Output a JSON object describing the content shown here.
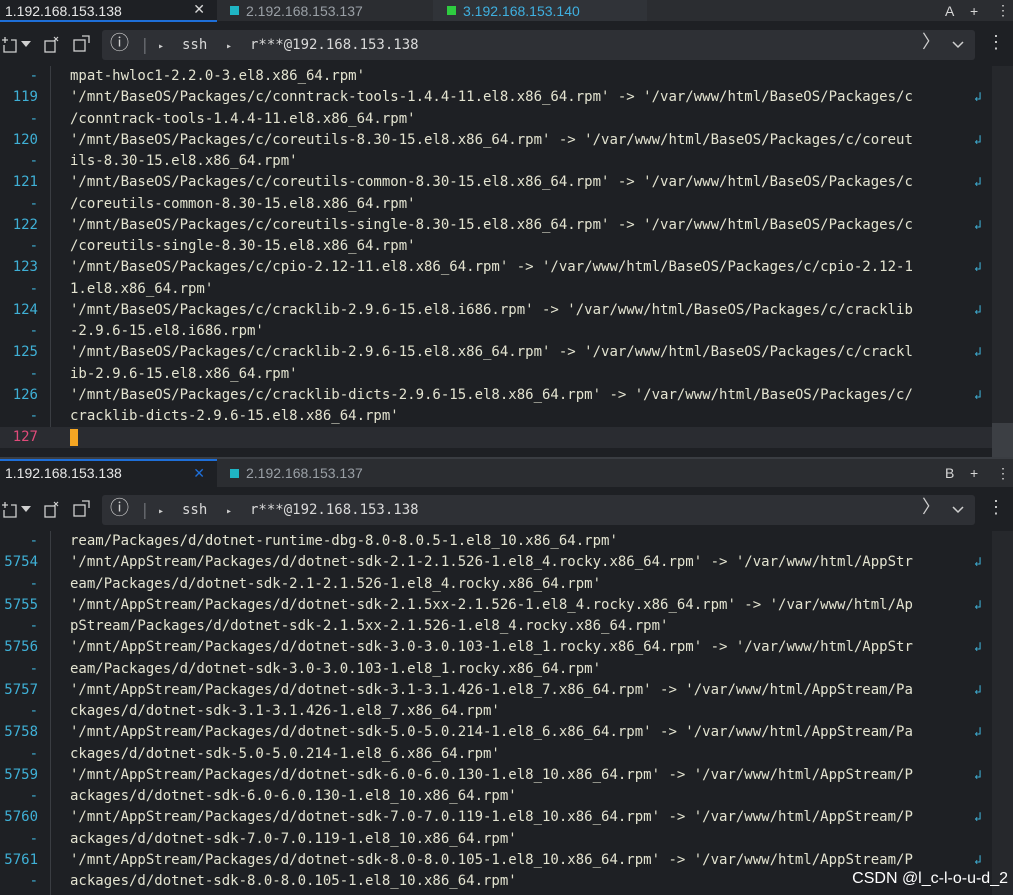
{
  "pane1": {
    "tabs": [
      {
        "label": "1.192.168.153.138",
        "color": "",
        "active": true
      },
      {
        "label": "2.192.168.153.137",
        "color": "#1fb5c4",
        "active": false
      },
      {
        "label": "3.192.168.153.140",
        "color": "#2ecc40",
        "active": false
      }
    ],
    "tab_close": "✕",
    "corner_letter": "A",
    "add_label": "+",
    "more_label": "⋮",
    "toolbar": {
      "info": "ⓘ",
      "protocol": "ssh",
      "host": "r***@192.168.153.138"
    },
    "lines": [
      {
        "num": "-",
        "text": "mpat-hwloc1-2.2.0-3.el8.x86_64.rpm'"
      },
      {
        "num": "119",
        "text": "'/mnt/BaseOS/Packages/c/conntrack-tools-1.4.4-11.el8.x86_64.rpm' -> '/var/www/html/BaseOS/Packages/c"
      },
      {
        "num": "-",
        "text": "/conntrack-tools-1.4.4-11.el8.x86_64.rpm'"
      },
      {
        "num": "120",
        "text": "'/mnt/BaseOS/Packages/c/coreutils-8.30-15.el8.x86_64.rpm' -> '/var/www/html/BaseOS/Packages/c/coreut"
      },
      {
        "num": "-",
        "text": "ils-8.30-15.el8.x86_64.rpm'"
      },
      {
        "num": "121",
        "text": "'/mnt/BaseOS/Packages/c/coreutils-common-8.30-15.el8.x86_64.rpm' -> '/var/www/html/BaseOS/Packages/c"
      },
      {
        "num": "-",
        "text": "/coreutils-common-8.30-15.el8.x86_64.rpm'"
      },
      {
        "num": "122",
        "text": "'/mnt/BaseOS/Packages/c/coreutils-single-8.30-15.el8.x86_64.rpm' -> '/var/www/html/BaseOS/Packages/c"
      },
      {
        "num": "-",
        "text": "/coreutils-single-8.30-15.el8.x86_64.rpm'"
      },
      {
        "num": "123",
        "text": "'/mnt/BaseOS/Packages/c/cpio-2.12-11.el8.x86_64.rpm' -> '/var/www/html/BaseOS/Packages/c/cpio-2.12-1"
      },
      {
        "num": "-",
        "text": "1.el8.x86_64.rpm'"
      },
      {
        "num": "124",
        "text": "'/mnt/BaseOS/Packages/c/cracklib-2.9.6-15.el8.i686.rpm' -> '/var/www/html/BaseOS/Packages/c/cracklib"
      },
      {
        "num": "-",
        "text": "-2.9.6-15.el8.i686.rpm'"
      },
      {
        "num": "125",
        "text": "'/mnt/BaseOS/Packages/c/cracklib-2.9.6-15.el8.x86_64.rpm' -> '/var/www/html/BaseOS/Packages/c/crackl"
      },
      {
        "num": "-",
        "text": "ib-2.9.6-15.el8.x86_64.rpm'"
      },
      {
        "num": "126",
        "text": "'/mnt/BaseOS/Packages/c/cracklib-dicts-2.9.6-15.el8.x86_64.rpm' -> '/var/www/html/BaseOS/Packages/c/"
      },
      {
        "num": "-",
        "text": "cracklib-dicts-2.9.6-15.el8.x86_64.rpm'"
      }
    ],
    "prompt_line_num": "127"
  },
  "pane2": {
    "tabs": [
      {
        "label": "1.192.168.153.138",
        "color": "",
        "active": true
      },
      {
        "label": "2.192.168.153.137",
        "color": "#1fb5c4",
        "active": false
      }
    ],
    "tab_close": "✕",
    "corner_letter": "B",
    "add_label": "+",
    "more_label": "⋮",
    "toolbar": {
      "info": "ⓘ",
      "protocol": "ssh",
      "host": "r***@192.168.153.138"
    },
    "lines": [
      {
        "num": "-",
        "text": "ream/Packages/d/dotnet-runtime-dbg-8.0-8.0.5-1.el8_10.x86_64.rpm'"
      },
      {
        "num": "5754",
        "text": "'/mnt/AppStream/Packages/d/dotnet-sdk-2.1-2.1.526-1.el8_4.rocky.x86_64.rpm' -> '/var/www/html/AppStr"
      },
      {
        "num": "-",
        "text": "eam/Packages/d/dotnet-sdk-2.1-2.1.526-1.el8_4.rocky.x86_64.rpm'"
      },
      {
        "num": "5755",
        "text": "'/mnt/AppStream/Packages/d/dotnet-sdk-2.1.5xx-2.1.526-1.el8_4.rocky.x86_64.rpm' -> '/var/www/html/Ap"
      },
      {
        "num": "-",
        "text": "pStream/Packages/d/dotnet-sdk-2.1.5xx-2.1.526-1.el8_4.rocky.x86_64.rpm'"
      },
      {
        "num": "5756",
        "text": "'/mnt/AppStream/Packages/d/dotnet-sdk-3.0-3.0.103-1.el8_1.rocky.x86_64.rpm' -> '/var/www/html/AppStr"
      },
      {
        "num": "-",
        "text": "eam/Packages/d/dotnet-sdk-3.0-3.0.103-1.el8_1.rocky.x86_64.rpm'"
      },
      {
        "num": "5757",
        "text": "'/mnt/AppStream/Packages/d/dotnet-sdk-3.1-3.1.426-1.el8_7.x86_64.rpm' -> '/var/www/html/AppStream/Pa"
      },
      {
        "num": "-",
        "text": "ckages/d/dotnet-sdk-3.1-3.1.426-1.el8_7.x86_64.rpm'"
      },
      {
        "num": "5758",
        "text": "'/mnt/AppStream/Packages/d/dotnet-sdk-5.0-5.0.214-1.el8_6.x86_64.rpm' -> '/var/www/html/AppStream/Pa"
      },
      {
        "num": "-",
        "text": "ckages/d/dotnet-sdk-5.0-5.0.214-1.el8_6.x86_64.rpm'"
      },
      {
        "num": "5759",
        "text": "'/mnt/AppStream/Packages/d/dotnet-sdk-6.0-6.0.130-1.el8_10.x86_64.rpm' -> '/var/www/html/AppStream/P"
      },
      {
        "num": "-",
        "text": "ackages/d/dotnet-sdk-6.0-6.0.130-1.el8_10.x86_64.rpm'"
      },
      {
        "num": "5760",
        "text": "'/mnt/AppStream/Packages/d/dotnet-sdk-7.0-7.0.119-1.el8_10.x86_64.rpm' -> '/var/www/html/AppStream/P"
      },
      {
        "num": "-",
        "text": "ackages/d/dotnet-sdk-7.0-7.0.119-1.el8_10.x86_64.rpm'"
      },
      {
        "num": "5761",
        "text": "'/mnt/AppStream/Packages/d/dotnet-sdk-8.0-8.0.105-1.el8_10.x86_64.rpm' -> '/var/www/html/AppStream/P"
      },
      {
        "num": "-",
        "text": "ackages/d/dotnet-sdk-8.0-8.0.105-1.el8_10.x86_64.rpm'"
      }
    ]
  },
  "watermark": "CSDN @l_c-l-o-u-d_2",
  "icons": {
    "wrap": "wrap-line-icon",
    "info": "info-icon",
    "new_tab": "new-tab-icon",
    "duplicate": "duplicate-icon",
    "reconnect": "reconnect-icon",
    "chevron_right": "chevron-right-icon",
    "chevron_down": "chevron-down-icon"
  }
}
